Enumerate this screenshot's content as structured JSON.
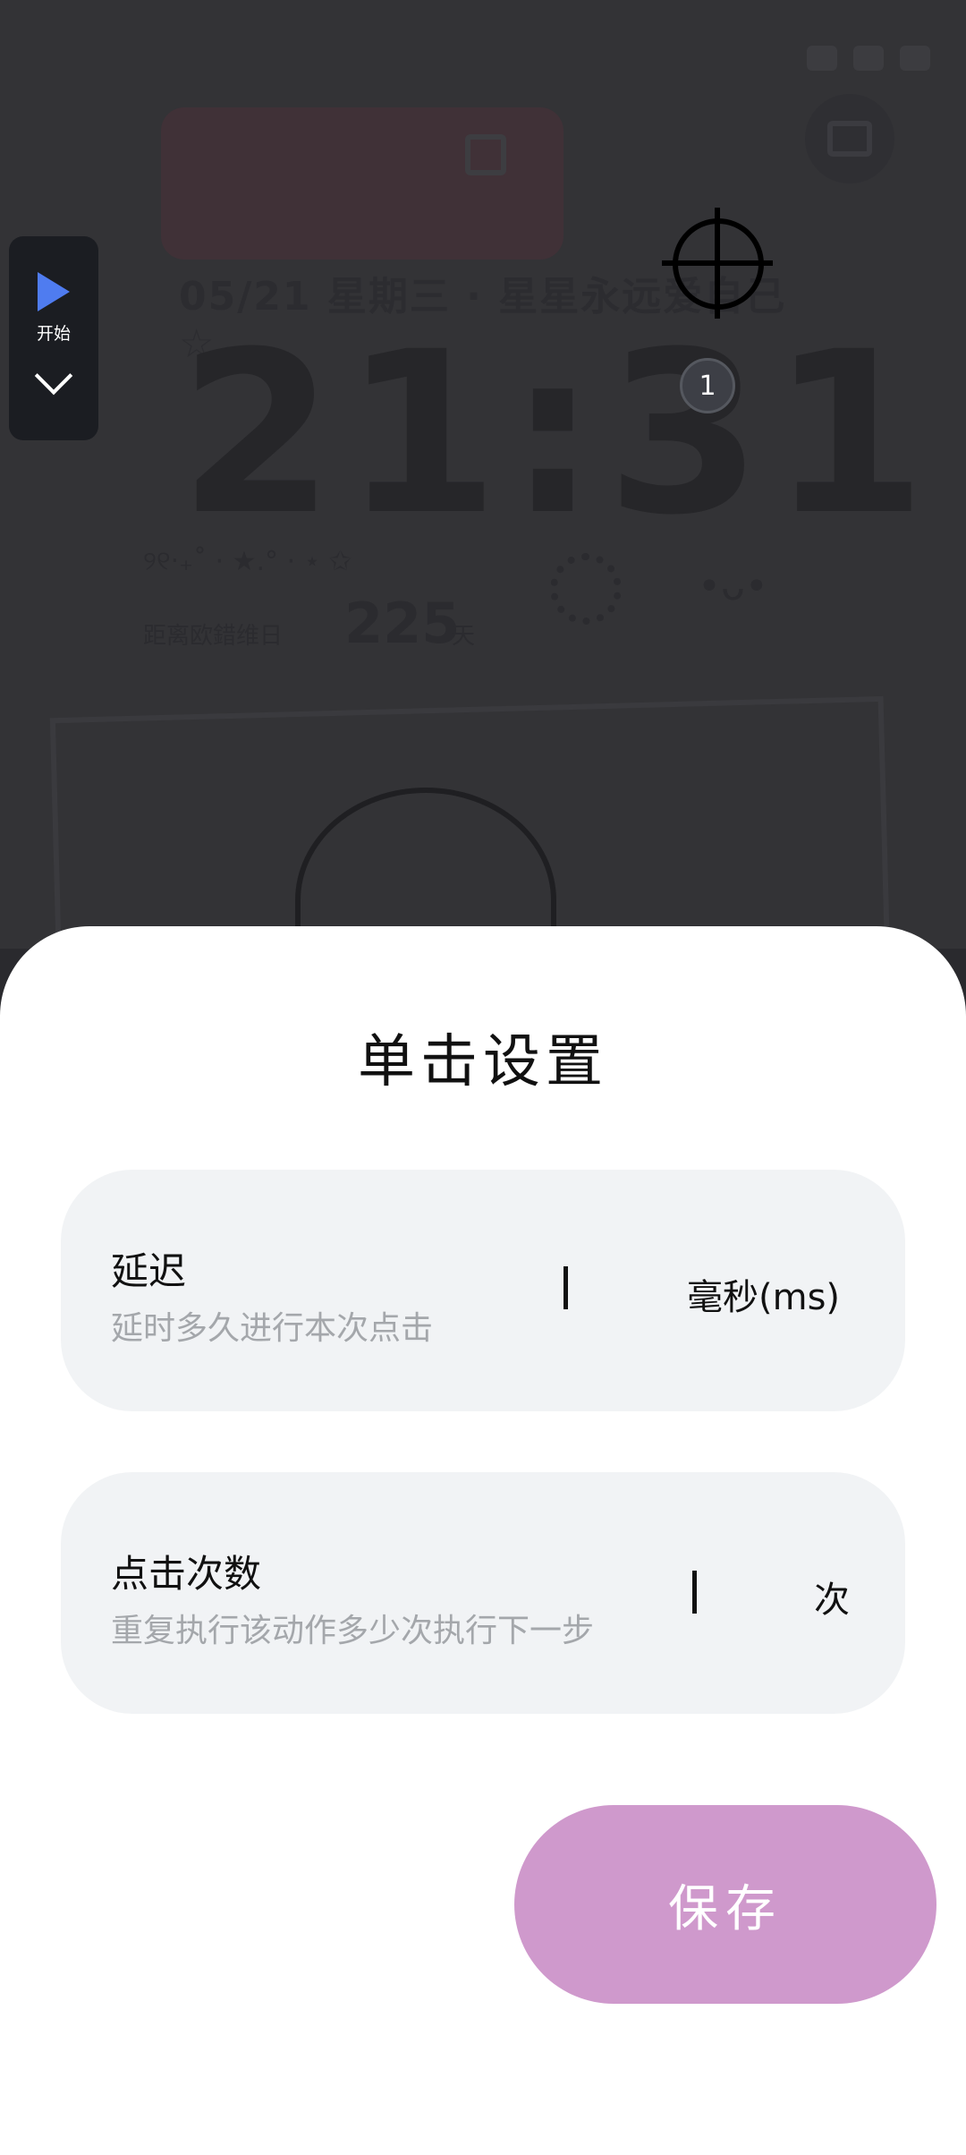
{
  "background": {
    "date_line": "05/21 星期三 · 星星永远爱自己 ☆",
    "clock": "21:31",
    "deco_text": "୨୧‧₊˚ ⋅ ★.° ⋅ ⋆ ✩",
    "countdown_label": "距离欧錯维日",
    "countdown_value": "225",
    "countdown_unit": "天",
    "face": "•ᴗ•"
  },
  "float_panel": {
    "start_label": "开始",
    "icons": [
      "play-icon",
      "chevron-down-icon"
    ],
    "accent": "#4f7cf0"
  },
  "click_target": {
    "index": "1"
  },
  "dialog": {
    "title": "单击设置",
    "delay": {
      "title": "延迟",
      "description": "延时多久进行本次点击",
      "value": "",
      "unit": "毫秒(ms)"
    },
    "count": {
      "title": "点击次数",
      "description": "重复执行该动作多少次执行下一步",
      "value": "",
      "unit": "次"
    },
    "save_label": "保存",
    "save_color": "#cf99cc"
  }
}
